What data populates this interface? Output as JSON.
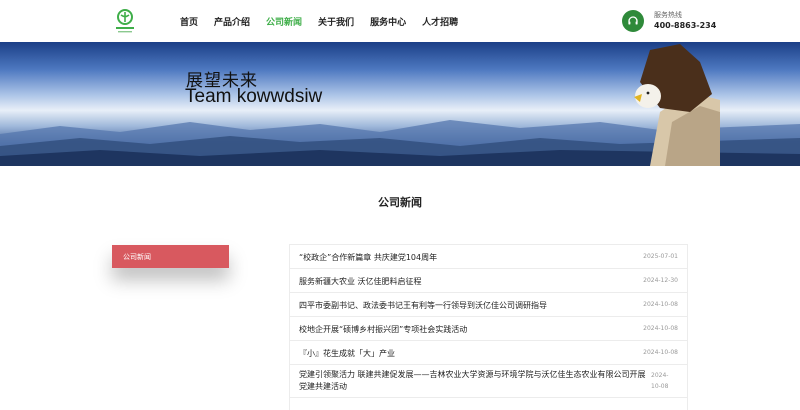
{
  "header": {
    "nav": [
      "首页",
      "产品介绍",
      "公司新闻",
      "关于我们",
      "服务中心",
      "人才招聘"
    ],
    "active_index": 2,
    "hotline_label": "服务热线",
    "hotline_number": "400-8863-234"
  },
  "banner": {
    "title": "展望未来",
    "subtitle": "Team kowwdsiw"
  },
  "section": {
    "title": "公司新闻"
  },
  "side_menu": {
    "label": "公司新闻"
  },
  "news": [
    {
      "title": "“校政企”合作新篇章 共庆建党104周年",
      "date": "2025-07-01"
    },
    {
      "title": "服务新疆大农业 沃亿佳肥料启征程",
      "date": "2024-12-30"
    },
    {
      "title": "四平市委副书记、政法委书记王有利等一行领导到沃亿佳公司调研指导",
      "date": "2024-10-08"
    },
    {
      "title": "校地企开展“硕博乡村振兴团”专项社会实践活动",
      "date": "2024-10-08"
    },
    {
      "title": "『小』花生成就「大」产业",
      "date": "2024-10-08"
    },
    {
      "title": "党建引领聚活力 联建共建促发展——吉林农业大学资源与环境学院与沃亿佳生态农业有限公司开展党建共建活动",
      "date": "2024-10-08"
    }
  ],
  "colors": {
    "accent": "#3fae49",
    "hotline_icon": "#2f8a3a",
    "side_menu": "#d8595f"
  }
}
